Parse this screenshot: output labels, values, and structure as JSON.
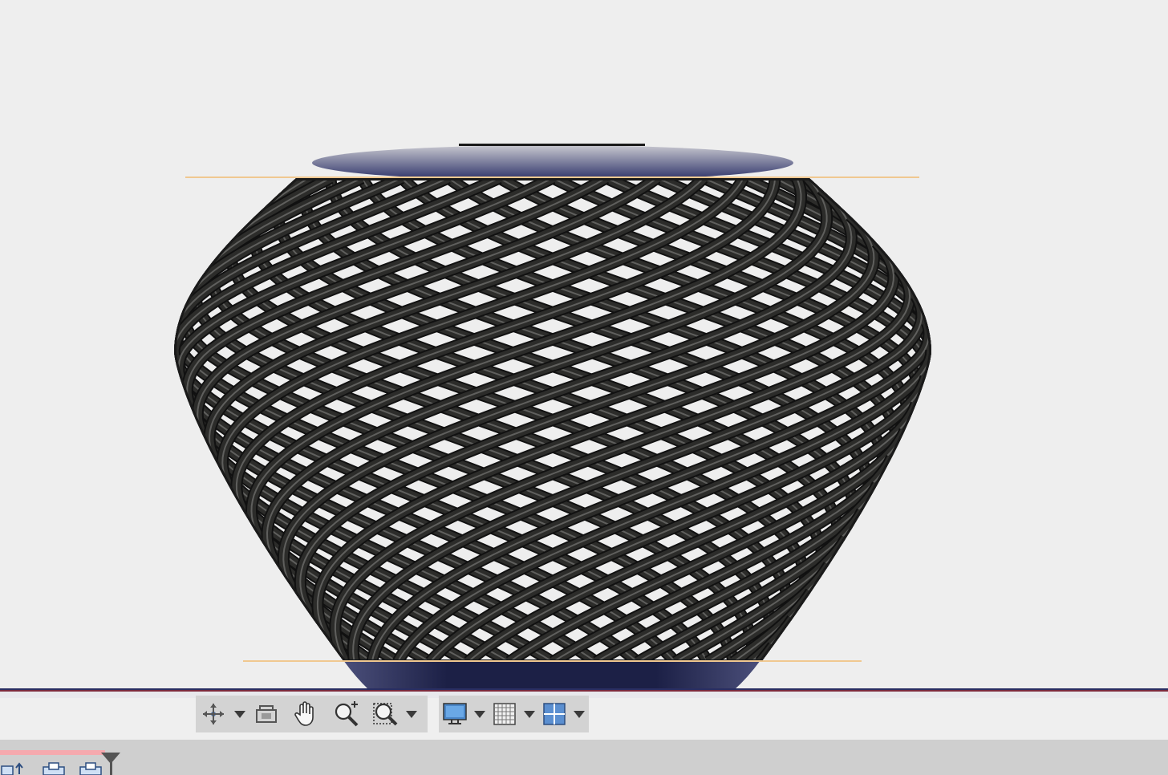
{
  "viewport": {
    "background": "#eeeeee",
    "model": "lattice-vase",
    "colors": {
      "lattice": "#2c2c2a",
      "lattice_edge": "#111111",
      "lattice_highlight": "#8a8a86",
      "base": "#1f2348",
      "guide_line": "#f0c890"
    }
  },
  "navigation_bar": {
    "left_group": [
      {
        "name": "orbit-icon",
        "dropdown": true
      },
      {
        "name": "look-at-icon",
        "dropdown": false
      },
      {
        "name": "pan-hand-icon",
        "dropdown": false
      },
      {
        "name": "zoom-icon",
        "dropdown": false
      },
      {
        "name": "zoom-window-icon",
        "dropdown": true
      }
    ],
    "right_group": [
      {
        "name": "display-settings-icon",
        "dropdown": true
      },
      {
        "name": "grid-icon",
        "dropdown": true
      },
      {
        "name": "viewports-icon",
        "dropdown": true
      }
    ]
  },
  "timeline": {
    "progress": 0.09,
    "progress_color": "#f5a9ae",
    "icons": [
      "feature-sketch-icon",
      "feature-component-icon",
      "feature-component-icon"
    ]
  }
}
